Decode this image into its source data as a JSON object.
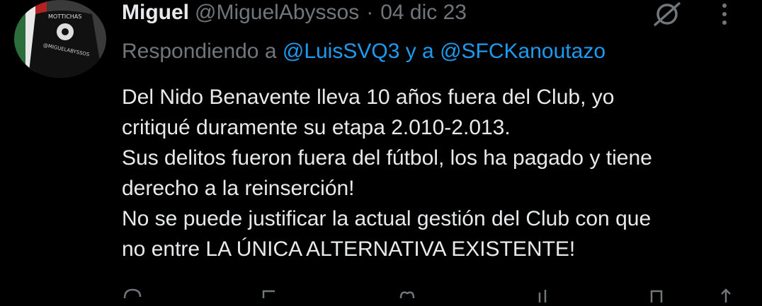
{
  "author": {
    "display_name": "Miguel",
    "handle": "@MiguelAbyssos",
    "separator": "·",
    "date": "04 dic 23",
    "avatar_text": "MOTTICHAS"
  },
  "reply_context": {
    "prefix": "Respondiendo a ",
    "mention1": "@LuisSVQ3",
    "connector": " y a ",
    "mention2": "@SFCKanoutazo"
  },
  "tweet": {
    "lines": [
      "Del Nido Benavente lleva 10 años fuera del Club, yo",
      "critiqué duramente su etapa 2.010-2.013.",
      "Sus delitos fueron fuera del fútbol, los ha pagado y tiene",
      "derecho a la reinserción!",
      "No se puede justificar la actual gestión del Club con que",
      "no entre LA ÚNICA ALTERNATIVA EXISTENTE!"
    ]
  },
  "icons": {
    "grok": "grok-icon",
    "more": "more-dots-icon",
    "reply": "reply-icon",
    "retweet": "retweet-icon",
    "like": "heart-icon",
    "views": "views-icon",
    "bookmark": "bookmark-icon",
    "share": "share-icon"
  },
  "colors": {
    "background": "#000000",
    "text": "#e7e9ea",
    "muted": "#71767b",
    "link": "#1d9bf0"
  }
}
